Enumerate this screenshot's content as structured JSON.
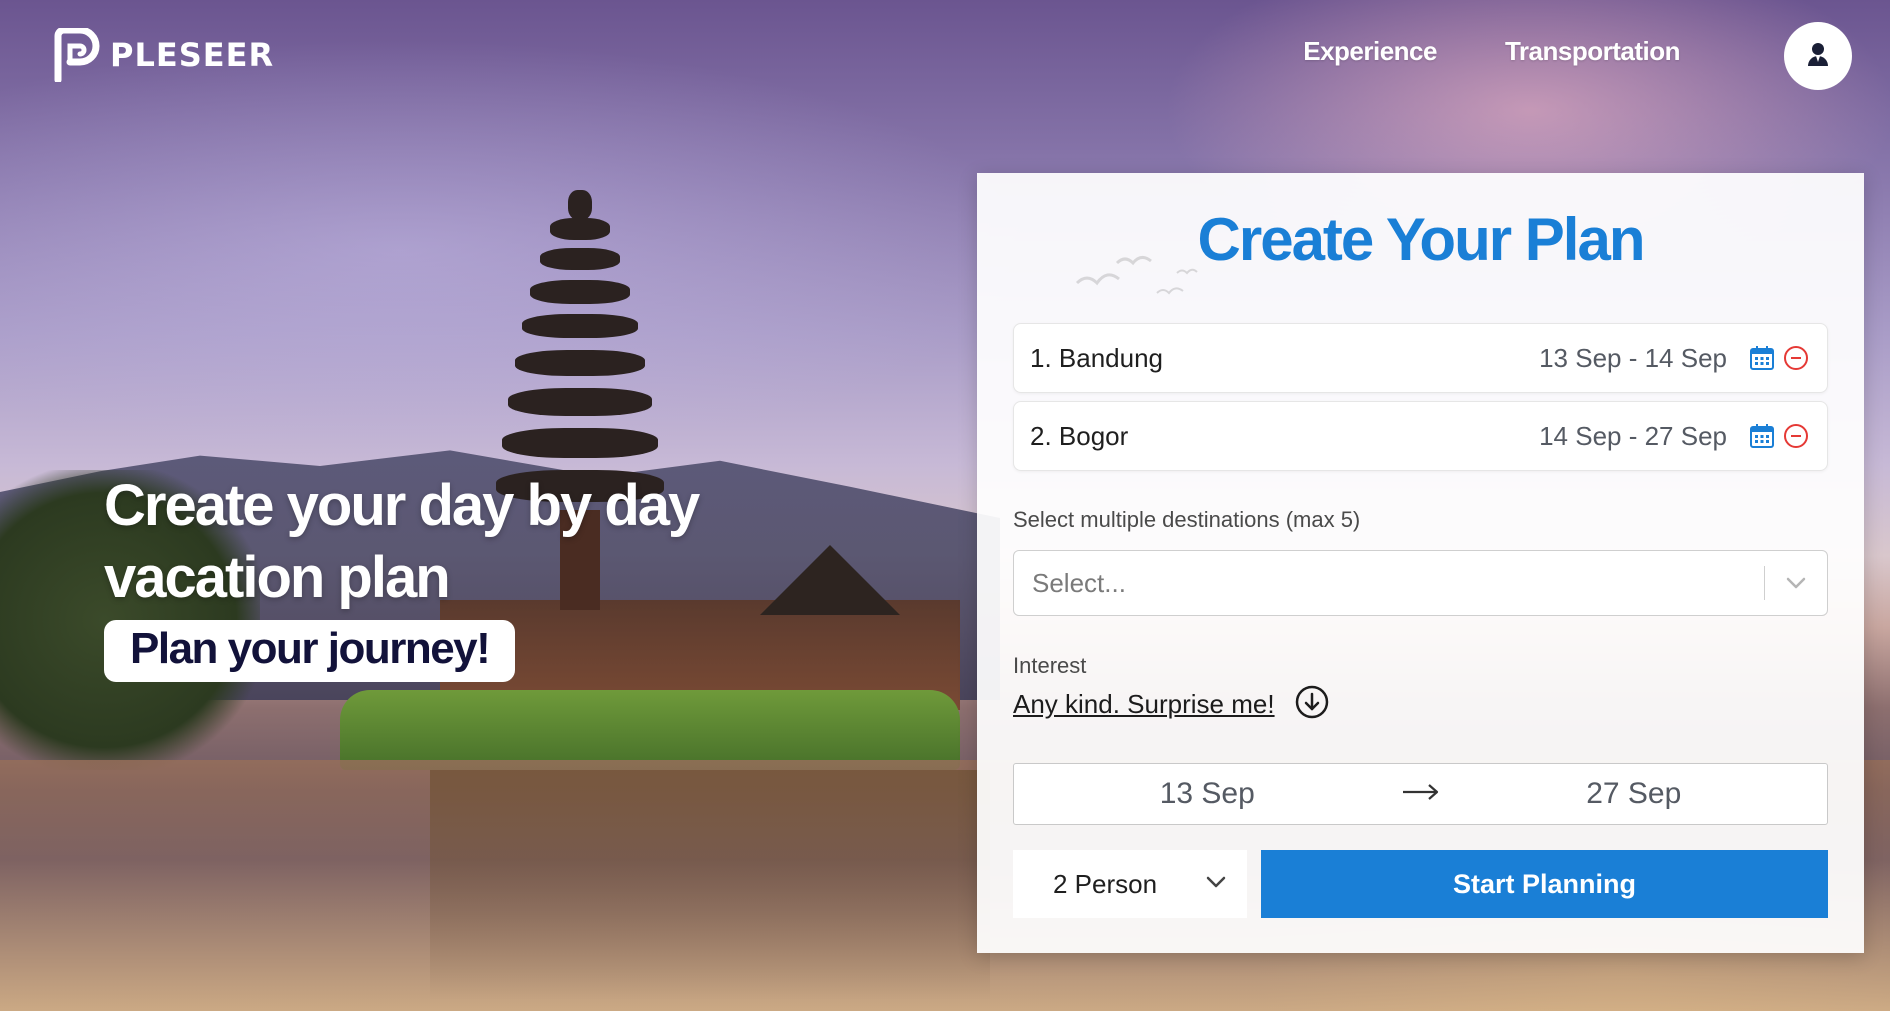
{
  "brand": {
    "name": "PLESEER"
  },
  "nav": {
    "items": [
      {
        "label": "Experience"
      },
      {
        "label": "Transportation"
      }
    ]
  },
  "hero": {
    "title": "Create your day by day vacation plan",
    "badge": "Plan your journey!"
  },
  "plan": {
    "title": "Create Your Plan",
    "destinations": [
      {
        "name": "1. Bandung",
        "dates": "13 Sep - 14 Sep"
      },
      {
        "name": "2. Bogor",
        "dates": "14 Sep - 27 Sep"
      }
    ],
    "select_label": "Select multiple destinations (max 5)",
    "select_placeholder": "Select...",
    "interest_label": "Interest",
    "interest_value": "Any kind. Surprise me!",
    "date_start": "13 Sep",
    "date_end": "27 Sep",
    "persons": "2 Person",
    "start_label": "Start Planning"
  },
  "colors": {
    "accent": "#1a7fd6",
    "remove": "#e53935"
  },
  "icons": {
    "calendar": "calendar-icon",
    "remove": "remove-circle-icon",
    "chevron": "chevron-down-icon",
    "arrow": "arrow-right-icon",
    "interest": "arrow-down-circle-icon",
    "user": "user-icon"
  }
}
